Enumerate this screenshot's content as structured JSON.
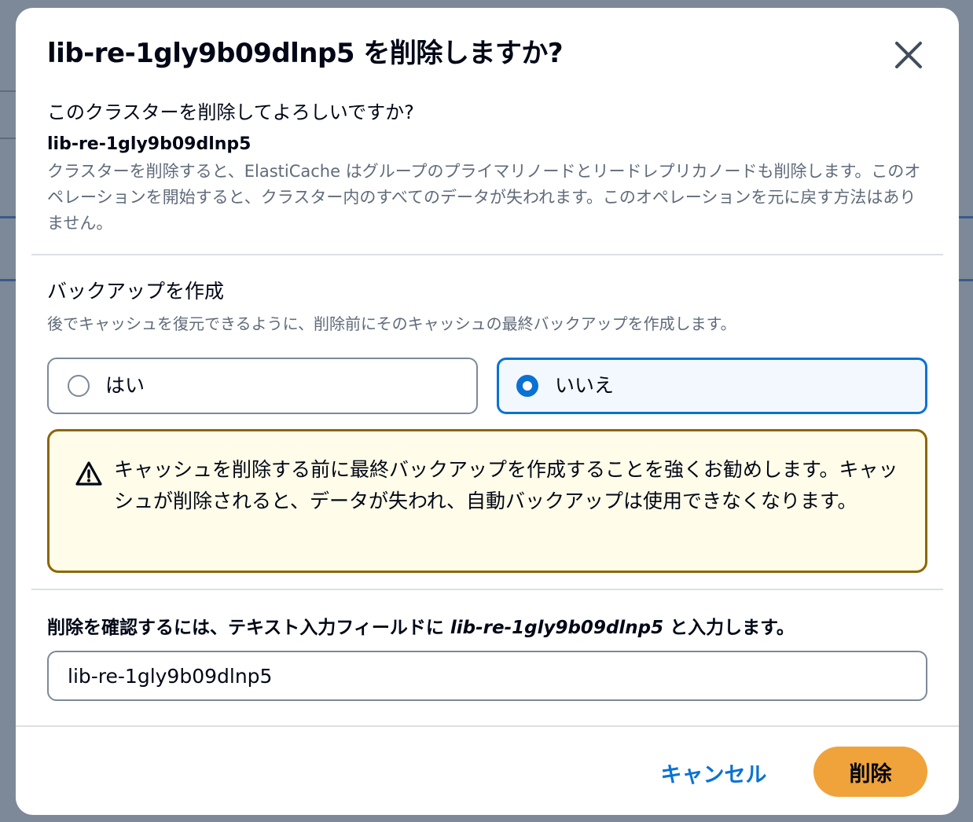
{
  "modal": {
    "title": "lib-re-1gly9b09dlnp5 を削除しますか?",
    "close_icon": "close-icon",
    "question": "このクラスターを削除してよろしいですか?",
    "cluster_id": "lib-re-1gly9b09dlnp5",
    "description": "クラスターを削除すると、ElastiCache はグループのプライマリノードとリードレプリカノードも削除します。このオペレーションを開始すると、クラスター内のすべてのデータが失われます。このオペレーションを元に戻す方法はありません。"
  },
  "backup": {
    "title": "バックアップを作成",
    "description": "後でキャッシュを復元できるように、削除前にそのキャッシュの最終バックアップを作成します。",
    "options": [
      {
        "label": "はい",
        "selected": false
      },
      {
        "label": "いいえ",
        "selected": true
      }
    ]
  },
  "warning": {
    "icon": "warning-icon",
    "text": "キャッシュを削除する前に最終バックアップを作成することを強くお勧めします。キャッシュが削除されると、データが失われ、自動バックアップは使用できなくなります。"
  },
  "confirm": {
    "label_prefix": "削除を確認するには、テキスト入力フィールドに ",
    "label_id": "lib-re-1gly9b09dlnp5",
    "label_suffix": " と入力します。",
    "input_value": "lib-re-1gly9b09dlnp5"
  },
  "footer": {
    "cancel_label": "キャンセル",
    "delete_label": "削除"
  },
  "colors": {
    "accent": "#0972d3",
    "primary_button": "#f0a33a",
    "warning_border": "#8d6605",
    "warning_bg": "#fffce9"
  }
}
